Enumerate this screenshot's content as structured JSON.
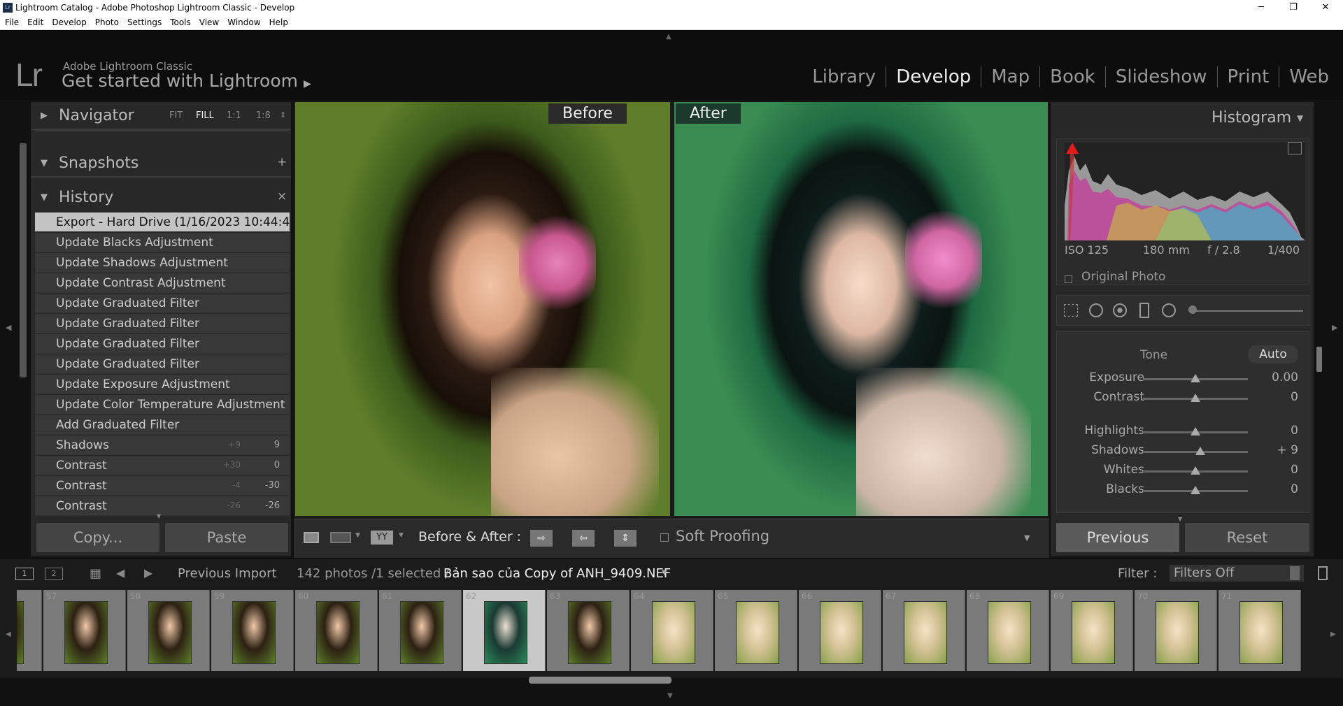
{
  "window": {
    "title": "Lightroom Catalog - Adobe Photoshop Lightroom Classic - Develop",
    "minimize": "─",
    "maximize": "❐",
    "close": "✕"
  },
  "menu": [
    "File",
    "Edit",
    "Develop",
    "Photo",
    "Settings",
    "Tools",
    "View",
    "Window",
    "Help"
  ],
  "identity": {
    "logo": "Lr",
    "brand": "Adobe Lightroom Classic",
    "tagline": "Get started with Lightroom",
    "tagline_arrow": "▶"
  },
  "modules": [
    "Library",
    "Develop",
    "Map",
    "Book",
    "Slideshow",
    "Print",
    "Web"
  ],
  "left_panel": {
    "navigator": {
      "title": "Navigator",
      "zooms": [
        "FIT",
        "FILL",
        "1:1",
        "1:8"
      ],
      "zoom_more": "⇕"
    },
    "snapshots": {
      "title": "Snapshots",
      "add": "+"
    },
    "history": {
      "title": "History",
      "clear": "×",
      "items": [
        {
          "label": "Export - Hard Drive (1/16/2023 10:44:4...",
          "before": "",
          "after": ""
        },
        {
          "label": "Update Blacks Adjustment",
          "before": "",
          "after": ""
        },
        {
          "label": "Update Shadows Adjustment",
          "before": "",
          "after": ""
        },
        {
          "label": "Update Contrast Adjustment",
          "before": "",
          "after": ""
        },
        {
          "label": "Update Graduated Filter",
          "before": "",
          "after": ""
        },
        {
          "label": "Update Graduated Filter",
          "before": "",
          "after": ""
        },
        {
          "label": "Update Graduated Filter",
          "before": "",
          "after": ""
        },
        {
          "label": "Update Graduated Filter",
          "before": "",
          "after": ""
        },
        {
          "label": "Update Exposure Adjustment",
          "before": "",
          "after": ""
        },
        {
          "label": "Update Color Temperature Adjustment",
          "before": "",
          "after": ""
        },
        {
          "label": "Add Graduated Filter",
          "before": "",
          "after": ""
        },
        {
          "label": "Shadows",
          "before": "+9",
          "after": "9"
        },
        {
          "label": "Contrast",
          "before": "+30",
          "after": "0"
        },
        {
          "label": "Contrast",
          "before": "-4",
          "after": "-30"
        },
        {
          "label": "Contrast",
          "before": "-26",
          "after": "-26"
        }
      ]
    },
    "copy": "Copy...",
    "paste": "Paste"
  },
  "view": {
    "before_label": "Before",
    "after_label": "After"
  },
  "toolbar": {
    "before_after": "Before & After :",
    "view_mode": "YY",
    "soft_proofing": "Soft Proofing"
  },
  "right_panel": {
    "histogram": {
      "title": "Histogram",
      "iso": "ISO 125",
      "focal": "180 mm",
      "aperture": "f / 2.8",
      "shutter": "1/400",
      "original_photo": "Original Photo"
    },
    "tone": {
      "title": "Tone",
      "auto": "Auto"
    },
    "sliders": [
      {
        "name": "Exposure",
        "value": "0.00",
        "pos": 0.5
      },
      {
        "name": "Contrast",
        "value": "0",
        "pos": 0.5
      },
      {
        "name": "Highlights",
        "value": "0",
        "pos": 0.5
      },
      {
        "name": "Shadows",
        "value": "+ 9",
        "pos": 0.545
      },
      {
        "name": "Whites",
        "value": "0",
        "pos": 0.5
      },
      {
        "name": "Blacks",
        "value": "0",
        "pos": 0.5
      }
    ],
    "previous": "Previous",
    "reset": "Reset"
  },
  "filmbar": {
    "page1": "1",
    "page2": "2",
    "source": "Previous Import",
    "count": "142 photos /1 selected /",
    "filename": "Bản sao của Copy of ANH_9409.NEF",
    "filter_label": "Filter :",
    "filter_value": "Filters Off"
  },
  "filmstrip": [
    "",
    "57",
    "58",
    "59",
    "60",
    "61",
    "62",
    "63",
    "64",
    "65",
    "66",
    "67",
    "68",
    "69",
    "70",
    "71"
  ],
  "colors": {
    "accent": "#c4c4c4",
    "bg": "#111111",
    "panel": "#282828"
  }
}
